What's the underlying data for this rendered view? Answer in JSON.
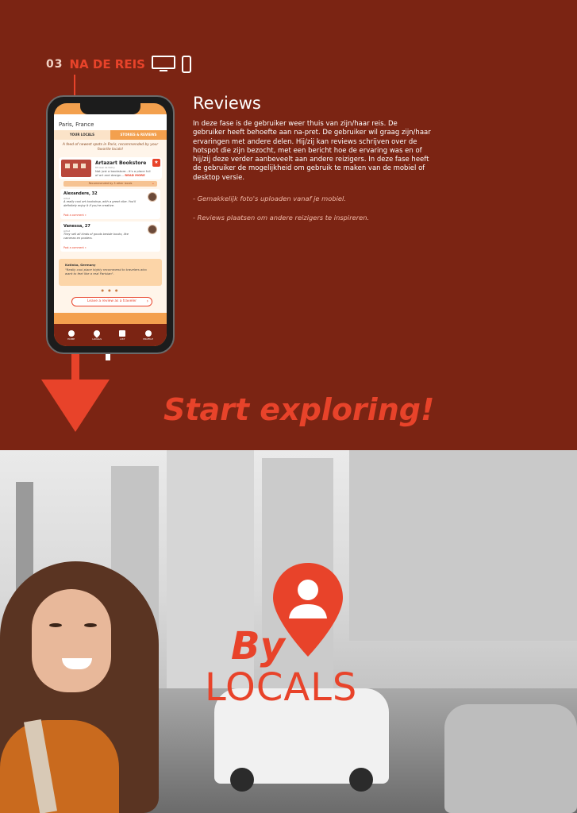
{
  "section": {
    "number": "03",
    "title": "NA DE REIS"
  },
  "icons": {
    "monitor": "monitor-icon",
    "phone": "smartphone-icon",
    "pin": "location-pin-person-icon"
  },
  "colors": {
    "background": "#7b2413",
    "accent": "#e8432a",
    "app_orange": "#f3a04e"
  },
  "app": {
    "location": "Paris, France",
    "tabs": [
      "YOUR LOCALS",
      "STORIES & REVIEWS"
    ],
    "feed_intro": "A feed of newest spots in Paris, recommended by your favorite locals!",
    "spot": {
      "title": "Artazart Bookstore",
      "meta": "83 Quai de Valmy",
      "description": "Not just a bookstore.. it's a place full of art and design...",
      "read_more": "READ MORE"
    },
    "recommended": "Recommended by 3 other locals",
    "reviews": [
      {
        "name": "Alexandere, 32",
        "role": "Artist",
        "text": "A really cool art bookshop, with a great vibe. You'll definitely enjoy it if you're creative.",
        "link": "Post a comment »"
      },
      {
        "name": "Vanessa, 27",
        "role": "Artist",
        "text": "They sell all kinds of goods beside books, like cameras en posters.",
        "link": "Post a comment »"
      }
    ],
    "quote": {
      "name": "Katinka, Germany",
      "text": "\"Really cool place highly recommend to travelers who want to feel like a real Parisian\"."
    },
    "leave_review": "Leave a review as a traveler",
    "nav": [
      "HOME",
      "LOCALS",
      "LIST",
      "PROFILE"
    ]
  },
  "content": {
    "title": "Reviews",
    "body": "In deze fase is de gebruiker weer thuis van zijn/haar reis. De gebruiker heeft behoefte aan na-pret. De gebruiker wil graag zijn/haar ervaringen met andere delen. Hij/zij kan reviews schrijven over de hotspot die zijn bezocht, met een bericht hoe de ervaring was en of hij/zij deze verder aanbeveelt aan andere reizigers. In deze fase heeft de gebruiker de mogelijkheid om gebruik te maken van de mobiel of desktop versie.",
    "bullet1": "- Gemakkelijk foto's uploaden vanaf je mobiel.",
    "bullet2": "- Reviews plaatsen om andere reizigers te inspireren."
  },
  "slogan": "Start exploring!",
  "logo": {
    "by": "By",
    "locals": "LOCALS"
  }
}
